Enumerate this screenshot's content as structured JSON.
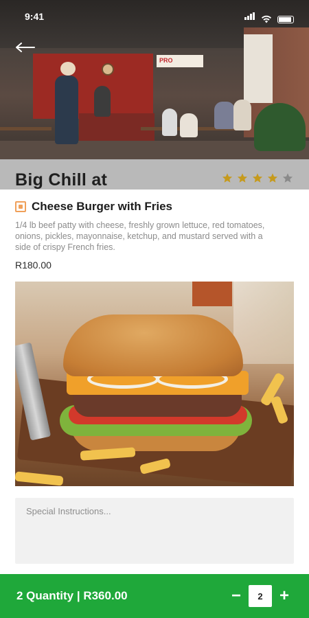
{
  "status_bar": {
    "time": "9:41"
  },
  "restaurant": {
    "name": "Big Chill at",
    "rating": 4,
    "rating_max": 5,
    "star_color": "#c69a1c",
    "star_empty_color": "#8a8a8a"
  },
  "hero": {
    "sign_text": "PRO"
  },
  "item": {
    "title": "Cheese Burger with Fries",
    "description": "1/4 lb beef patty with cheese, freshly grown lettuce, red tomatoes, onions, pickles, mayonnaise, ketchup, and mustard served with a side of crispy French fries.",
    "price": "R180.00",
    "veg_icon": "food-type-icon"
  },
  "instructions": {
    "placeholder": "Special Instructions..."
  },
  "cart": {
    "summary": "2 Quantity | R360.00",
    "quantity": "2",
    "decrement_label": "−",
    "increment_label": "+",
    "accent_color": "#1fa83a"
  }
}
